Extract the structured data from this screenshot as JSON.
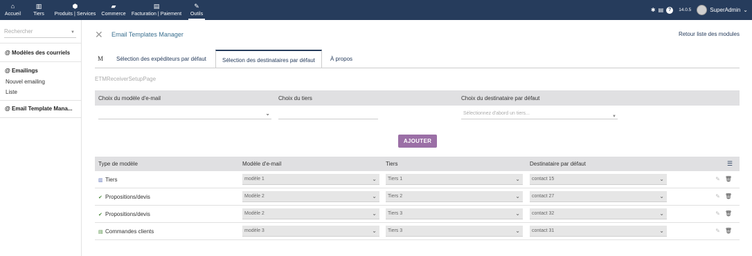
{
  "topbar": {
    "nav": [
      {
        "label": "Accueil",
        "icon": "home-icon",
        "glyph": "⌂"
      },
      {
        "label": "Tiers",
        "icon": "building-icon",
        "glyph": "▥"
      },
      {
        "label": "Produits | Services",
        "icon": "cube-icon",
        "glyph": "⬢"
      },
      {
        "label": "Commerce",
        "icon": "briefcase-icon",
        "glyph": "▰"
      },
      {
        "label": "Facturation | Paiement",
        "icon": "money-icon",
        "glyph": "▤"
      },
      {
        "label": "Outils",
        "icon": "wrench-icon",
        "glyph": "✎"
      }
    ],
    "right": {
      "bug_glyph": "✱",
      "print_glyph": "▤",
      "help_glyph": "?",
      "version": "14.0.5",
      "user": "SuperAdmin",
      "user_caret": "⌄"
    }
  },
  "sidebar": {
    "search_placeholder": "Rechercher",
    "search_caret": "▼",
    "sections": [
      {
        "title": "@ Modèles des courriels",
        "links": []
      },
      {
        "title": "@ Emailings",
        "links": [
          "Nouvel emailing",
          "Liste"
        ]
      },
      {
        "title": "@ Email Template Mana..."
      }
    ]
  },
  "main": {
    "module_icon_glyph": "✕",
    "module_title": "Email Templates Manager",
    "back_link": "Retour liste des modules",
    "tab_m": "M",
    "tabs": [
      "Sélection des expéditeurs par défaut",
      "Sélection des destinataires par défaut",
      "À propos"
    ],
    "subtitle": "ETMReceiverSetupPage",
    "form": {
      "label_model": "Choix du modèle d'e-mail",
      "label_tiers": "Choix du tiers",
      "label_dest": "Choix du destinataire par défaut",
      "dest_placeholder": "Sélectionnez d'abord un tiers...",
      "chevron": "⌄",
      "caret": "▼"
    },
    "add_button": "AJOUTER",
    "table": {
      "headers": [
        "Type de modèle",
        "Modèle d'e-mail",
        "Tiers",
        "Destinataire par défaut"
      ],
      "list_icon_glyph": "☰",
      "pencil_glyph": "✎",
      "trash_glyph": "🗑",
      "chevron": "⌄",
      "rows": [
        {
          "type": "Tiers",
          "type_glyph": "▥",
          "type_color": "#5b6fb5",
          "model": "modèle 1",
          "tiers": "Tiers 1",
          "contact": "contact 15"
        },
        {
          "type": "Propositions/devis",
          "type_glyph": "✔",
          "type_color": "#4a8a3a",
          "model": "Modèle 2",
          "tiers": "Tiers 2",
          "contact": "contact 27"
        },
        {
          "type": "Propositions/devis",
          "type_glyph": "✔",
          "type_color": "#4a8a3a",
          "model": "Modèle 2",
          "tiers": "Tiers 3",
          "contact": "contact 32"
        },
        {
          "type": "Commandes clients",
          "type_glyph": "▤",
          "type_color": "#4a8a3a",
          "model": "modèle 3",
          "tiers": "Tiers 3",
          "contact": "contact 31"
        }
      ]
    }
  },
  "colors": {
    "topbar": "#263c5c",
    "accent_button": "#9b6fa6",
    "header_bg": "#e0e0e2"
  }
}
